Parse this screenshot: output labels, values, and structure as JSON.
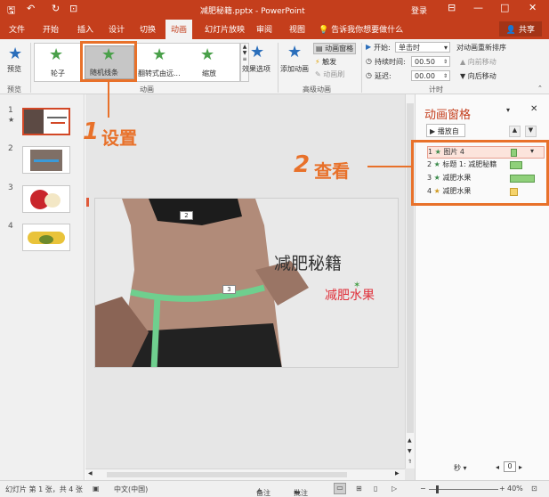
{
  "titlebar": {
    "quick_save": "🖫",
    "quick_undo": "↶",
    "quick_redo": "↻",
    "quick_start": "⊡",
    "title": "减肥秘籍.pptx - PowerPoint",
    "login": "登录",
    "ribbon_display": "⊟",
    "minimize": "—",
    "maximize": "□",
    "close": "✕"
  },
  "tabs": {
    "file": "文件",
    "home": "开始",
    "insert": "插入",
    "design": "设计",
    "transitions": "切换",
    "animations": "动画",
    "slideshow": "幻灯片放映",
    "review": "审阅",
    "view": "视图",
    "tellme": "告诉我你想要做什么",
    "share": "共享"
  },
  "ribbon": {
    "preview": "预览",
    "preview_group": "预览",
    "gallery": [
      "轮子",
      "随机线条",
      "翻转式由远...",
      "缩放"
    ],
    "effect_options": "效果选项",
    "anim_group": "动画",
    "add_animation": "添加动画",
    "anim_pane": "动画窗格",
    "trigger": "触发",
    "painter": "动画刷",
    "advanced_group": "高级动画",
    "start_label": "开始:",
    "start_value": "单击时",
    "duration_label": "持续时间:",
    "duration_value": "00.50",
    "delay_label": "延迟:",
    "delay_value": "00.00",
    "reorder_title": "对动画重新排序",
    "move_earlier": "向前移动",
    "move_later": "向后移动",
    "timing_group": "计时"
  },
  "thumbs": [
    "1",
    "2",
    "3",
    "4"
  ],
  "slide": {
    "title": "减肥秘籍",
    "subtitle": "减肥水果",
    "tag_2": "2",
    "tag_3": "3"
  },
  "animpane": {
    "title": "动画窗格",
    "play": "播放自",
    "items": [
      {
        "num": "1",
        "label": "图片 4",
        "color": "#8fd07a"
      },
      {
        "num": "2",
        "label": "标题 1: 减肥秘籍",
        "color": "#8fd07a"
      },
      {
        "num": "3",
        "label": "减肥水果",
        "color": "#8fd07a"
      },
      {
        "num": "4",
        "label": "减肥水果",
        "color": "#f5d36b"
      }
    ],
    "seconds": "秒",
    "page_value": "0"
  },
  "callouts": {
    "step1_num": "1",
    "step1_text": "设置",
    "step2_num": "2",
    "step2_text": "查看"
  },
  "statusbar": {
    "slide_info": "幻灯片 第 1 张，共 4 张",
    "language": "中文(中国)",
    "notes": "备注",
    "comments": "批注",
    "zoom": "40%"
  },
  "colors": {
    "accent": "#c43e1c",
    "callout": "#e8712a"
  }
}
